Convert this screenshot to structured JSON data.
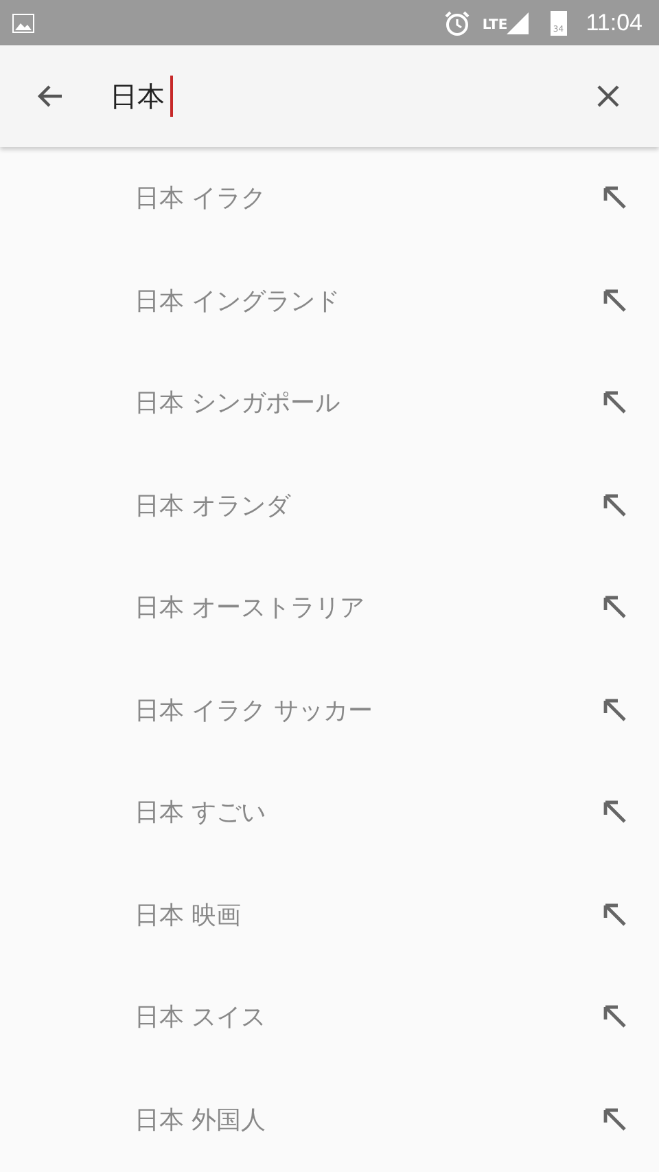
{
  "status_bar": {
    "network": "LTE",
    "battery": "34",
    "time": "11:04"
  },
  "search": {
    "value": "日本"
  },
  "suggestions": [
    {
      "text": "日本 イラク"
    },
    {
      "text": "日本 イングランド"
    },
    {
      "text": "日本 シンガポール"
    },
    {
      "text": "日本 オランダ"
    },
    {
      "text": "日本 オーストラリア"
    },
    {
      "text": "日本 イラク サッカー"
    },
    {
      "text": "日本 すごい"
    },
    {
      "text": "日本 映画"
    },
    {
      "text": "日本 スイス"
    },
    {
      "text": "日本 外国人"
    }
  ]
}
